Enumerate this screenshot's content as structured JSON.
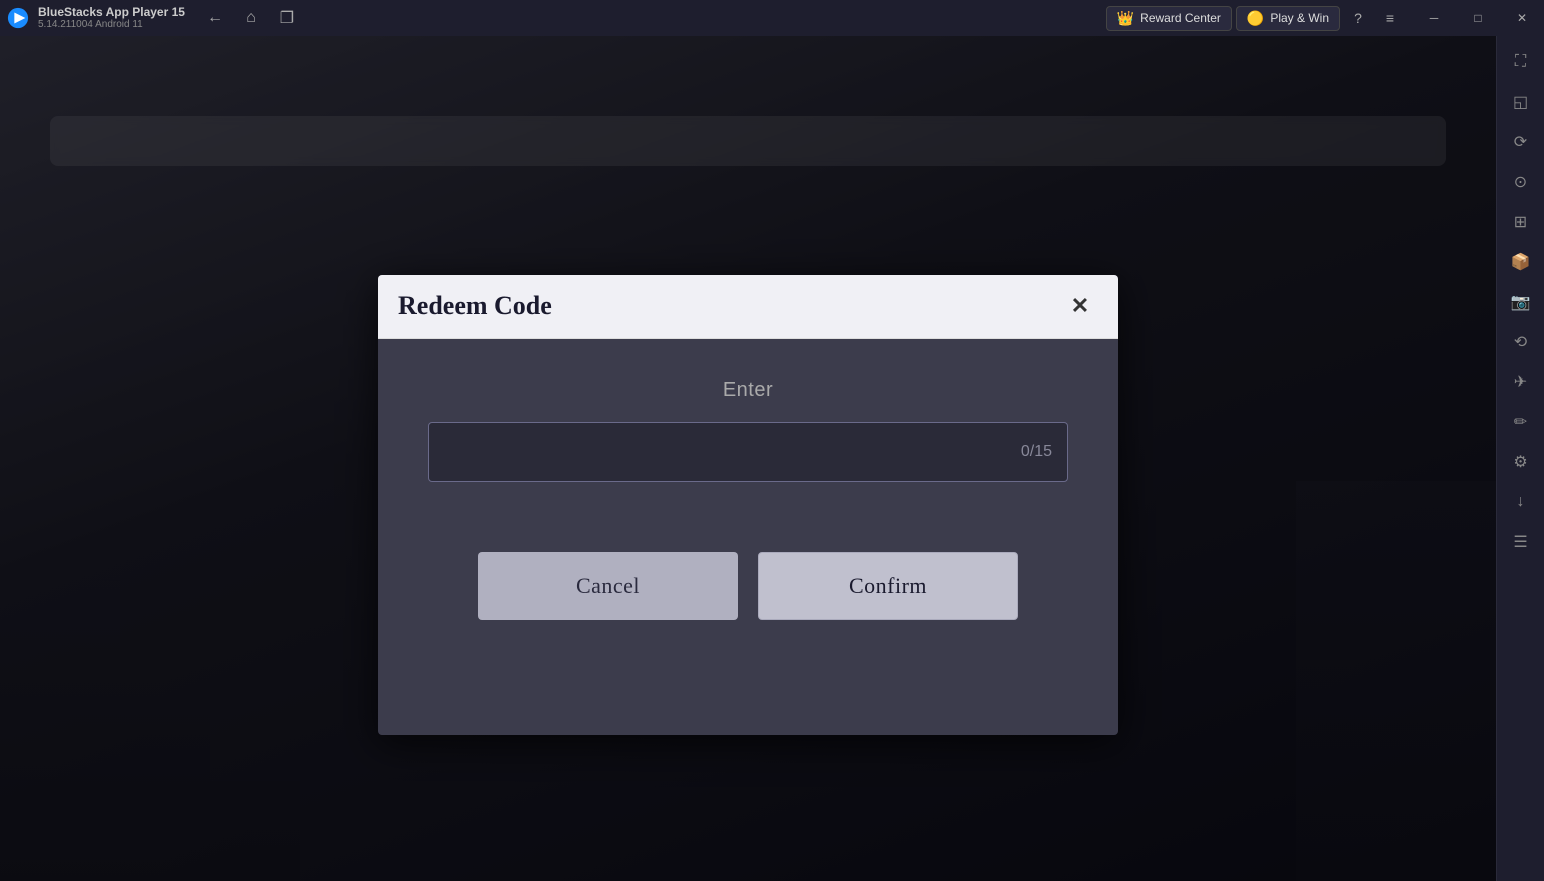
{
  "titlebar": {
    "logo_label": "BS",
    "app_name": "BlueStacks App Player 15",
    "app_version": "5.14.211004  Android 11",
    "nav": {
      "back_label": "←",
      "home_label": "⌂",
      "copy_label": "❐"
    },
    "reward_center_label": "Reward Center",
    "play_win_label": "Play & Win",
    "help_label": "?",
    "menu_label": "≡",
    "minimize_label": "─",
    "maximize_label": "□",
    "close_label": "✕",
    "fullscreen_label": "⛶"
  },
  "sidebar": {
    "icons": [
      {
        "name": "expand-icon",
        "symbol": "⛶"
      },
      {
        "name": "sidebar-icon-1",
        "symbol": "◱"
      },
      {
        "name": "sidebar-icon-2",
        "symbol": "⟳"
      },
      {
        "name": "sidebar-icon-3",
        "symbol": "◎"
      },
      {
        "name": "sidebar-icon-4",
        "symbol": "⊞"
      },
      {
        "name": "sidebar-icon-5",
        "symbol": "📷"
      },
      {
        "name": "sidebar-icon-6",
        "symbol": "⟲"
      },
      {
        "name": "sidebar-icon-7",
        "symbol": "✈"
      },
      {
        "name": "sidebar-icon-8",
        "symbol": "✏"
      },
      {
        "name": "sidebar-icon-9",
        "symbol": "⚙"
      },
      {
        "name": "sidebar-icon-10",
        "symbol": "↓"
      },
      {
        "name": "sidebar-icon-11",
        "symbol": "☰"
      }
    ]
  },
  "dialog": {
    "title": "Redeem Code",
    "close_label": "✕",
    "enter_label": "Enter",
    "code_input_placeholder": "",
    "code_counter": "0/15",
    "cancel_label": "Cancel",
    "confirm_label": "Confirm"
  }
}
